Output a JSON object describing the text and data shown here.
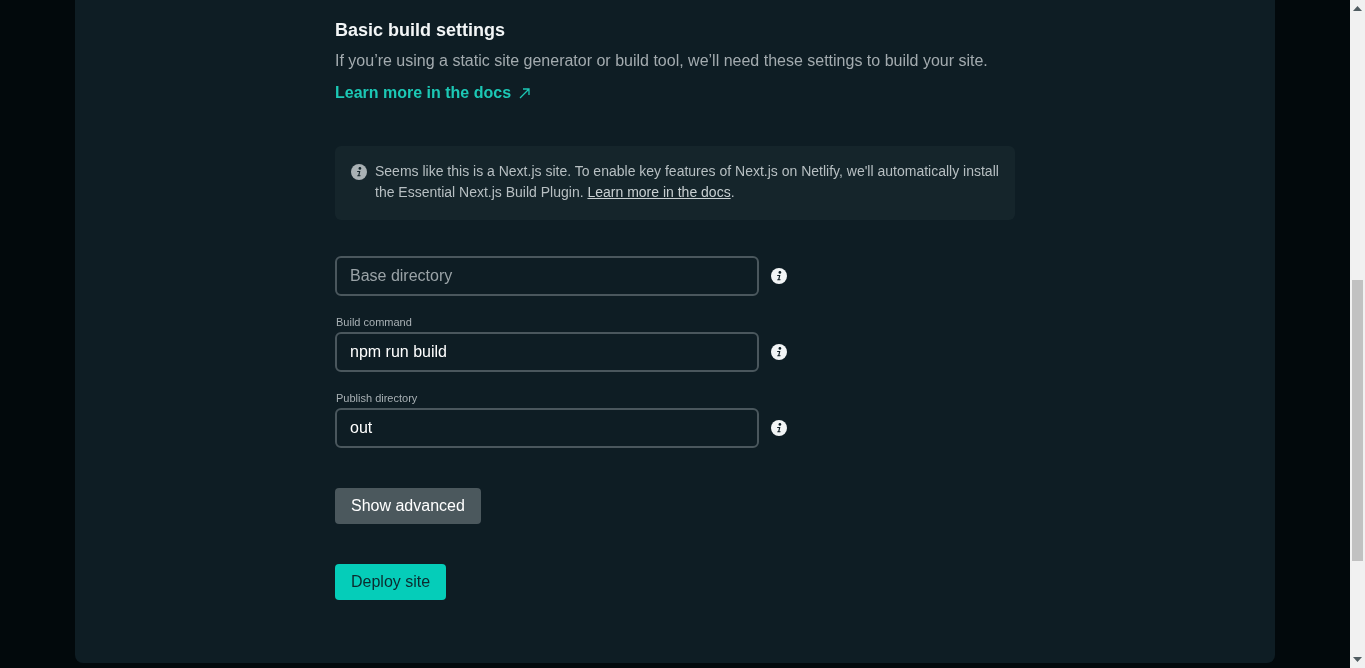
{
  "section": {
    "title": "Basic build settings",
    "description": "If you’re using a static site generator or build tool, we’ll need these settings to build your site.",
    "docs_link": "Learn more in the docs"
  },
  "notice": {
    "text": "Seems like this is a Next.js site. To enable key features of Next.js on Netlify, we'll automatically install the Essential Next.js Build Plugin.",
    "link": "Learn more in the docs",
    "text_after": "."
  },
  "fields": [
    {
      "placeholder": "Base directory"
    },
    {
      "label": "Build command",
      "value": "npm run build"
    },
    {
      "label": "Publish directory",
      "value": "out"
    }
  ],
  "buttons": [
    {
      "label": "Show advanced",
      "kind": "secondary"
    },
    {
      "label": "Deploy site",
      "kind": "primary"
    }
  ]
}
